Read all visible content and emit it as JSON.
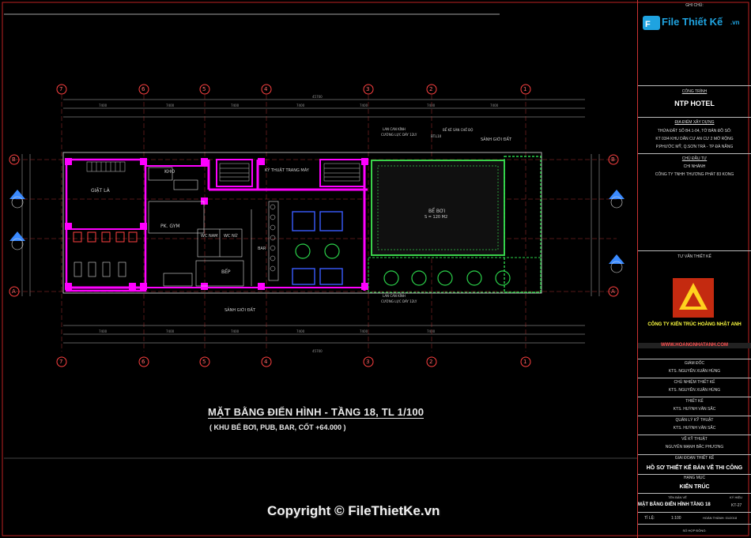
{
  "watermark": {
    "brand": "File Thiết Kế",
    "domain": ".vn",
    "copyright": "Copyright © FileThietKe.vn"
  },
  "title_block": {
    "ghi_chu": "GHI CHÚ:",
    "cong_trinh_label": "CÔNG TRÌNH",
    "cong_trinh": "NTP HOTEL",
    "dia_diem_label": "ĐỊA ĐIỂM XÂY DỰNG",
    "dia_diem_1": "THỬA ĐẤT SỐ B4.1-04, TỜ BẢN ĐỒ SỐ:",
    "dia_diem_2": "KT 03/4 KHU DÂN CƯ AN CƯ 2 MỞ RỘNG",
    "dia_diem_3": "P.PHƯỚC MỸ, Q.SƠN TRÀ - TP ĐÀ NẴNG",
    "chu_dau_tu_label": "CHỦ ĐẦU TƯ",
    "chi_nhanh": "CHI NHÁNH",
    "chu_dau_tu": "CÔNG TY TNHH THƯƠNG PHÁT 83 KONG",
    "tu_van_label": "TƯ VẤN THIẾT KẾ",
    "company": "CÔNG TY KIẾN TRÚC HOÀNG NHẬT ANH",
    "website": "WWW.HOANGNHATANH.COM",
    "giam_doc_label": "GIÁM ĐỐC",
    "giam_doc": "KTS. NGUYỄN XUÂN HÙNG",
    "chu_nhiem_label": "CHỦ NHIỆM THIẾT KẾ",
    "chu_nhiem": "KTS. NGUYỄN XUÂN HÙNG",
    "thiet_ke_label": "THIẾT KẾ",
    "thiet_ke": "KTS. HUỲNH VĂN SẮC",
    "kiem_tra_label": "QUẢN LÝ KỸ THUẬT",
    "kiem_tra": "KTS. HUỲNH VĂN SẮC",
    "ve_label": "VẼ KỸ THUẬT",
    "ve": "NGUYỄN MẠNH BẮC PHƯƠNG",
    "giai_doan_label": "GIAI ĐOẠN THIẾT KẾ",
    "giai_doan": "HỒ SƠ THIẾT KẾ BẢN VẼ THI CÔNG",
    "hang_muc_label": "HẠNG MỤC",
    "hang_muc": "KIẾN TRÚC",
    "ten_ban_ve_label": "TÊN BẢN VẼ",
    "ten_ban_ve": "MẶT BẰNG ĐIỂN HÌNH TẦNG 18",
    "ky_hieu_label": "KÝ HIỆU",
    "ky_hieu": "KT-27",
    "ti_le_label": "TỈ LỆ:",
    "ti_le": "1:100",
    "hoan_thanh": "HOÀN THÀNH: 01/2018",
    "so_hop_dong": "SỐ HỢP ĐỒNG:"
  },
  "drawing": {
    "title": "MẶT BẰNG ĐIỂN HÌNH - TẦNG 18,  TL 1/100",
    "subtitle": "( KHU BỂ BƠI, PUB, BAR, CỐT +64.000 )",
    "grid_top": [
      "7",
      "6",
      "5",
      "4",
      "3",
      "2",
      "1"
    ],
    "grid_side": [
      "B",
      "B",
      "A",
      "A"
    ],
    "rooms": {
      "giat_la": "GIẶT LÀ",
      "kho": "KHO",
      "gym": "PK. GYM",
      "wc_nam": "WC NAM",
      "wc_nu": "WC NỮ",
      "bep": "BẾP",
      "bar": "BAR",
      "ky_thuat": "KỸ THUẬT TRANG MÁY",
      "be_boi": "BỂ BƠI",
      "be_boi_area": "S = 120 M2",
      "sanh_top": "SẢNH GIỚI ĐẤT",
      "sanh_bottom": "SẢNH GIỚI ĐẤT",
      "lan_can_1": "LAN CAN KÍNH",
      "lan_can_2": "CƯỜNG LỰC DÀY 12LY",
      "be_ke": "BỂ KÊ SÀN CHẾ ĐỘ",
      "be_ke_2": "BT.L10"
    }
  }
}
